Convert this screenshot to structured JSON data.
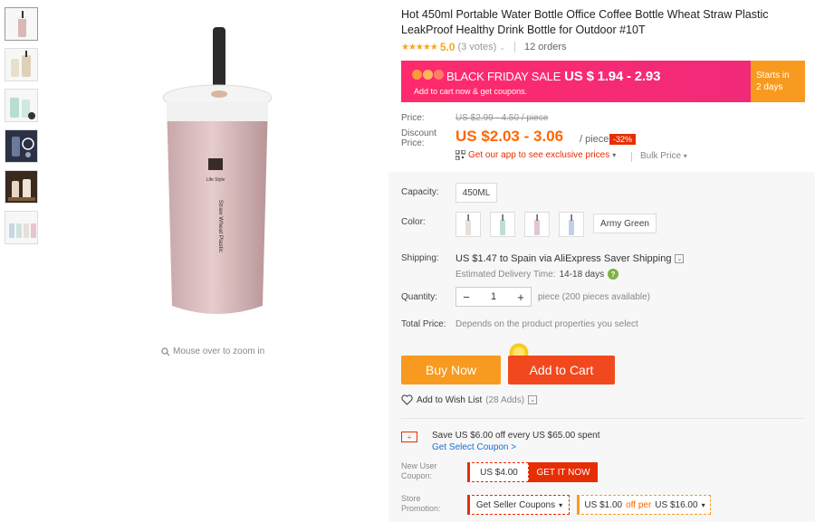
{
  "thumbnails": [
    {
      "name": "thumb-pink-bottle"
    },
    {
      "name": "thumb-beige-bottles"
    },
    {
      "name": "thumb-mint-bottles"
    },
    {
      "name": "thumb-dark-promo"
    },
    {
      "name": "thumb-lifestyle"
    },
    {
      "name": "thumb-four-colors"
    }
  ],
  "main_image": {
    "bottle_label": "Straw Wheat Plastic"
  },
  "zoom_hint": "Mouse over to zoom in",
  "product": {
    "title": "Hot 450ml Portable Water Bottle Office Coffee Bottle Wheat Straw Plastic LeakProof Healthy Drink Bottle for Outdoor #10T",
    "stars": "★★★★★",
    "rating": "5.0",
    "votes": "(3 votes)",
    "orders": "12 orders"
  },
  "banner": {
    "title": "BLACK FRIDAY SALE",
    "price": "US $ 1.94 - 2.93",
    "subtitle": "Add to cart now & get coupons.",
    "starts_label": "Starts in",
    "starts_value": "2 days",
    "color": "#ff2a6d",
    "side_color": "#f89a1f"
  },
  "price": {
    "price_label": "Price:",
    "old_price": "US $2.99 - 4.50 / piece",
    "discount_label": "Discount Price:",
    "new_price": "US $2.03 - 3.06",
    "per_piece": "/ piece",
    "discount_badge": "-32%",
    "app_link": "Get our app to see exclusive prices",
    "bulk_price": "Bulk Price"
  },
  "properties": {
    "capacity_label": "Capacity:",
    "capacity_value": "450ML",
    "color_label": "Color:",
    "color_swatches": [
      "#e8e0d8",
      "#cfe3dc",
      "#e6d5e3",
      "#c8d4e8"
    ],
    "color_text_option": "Army Green",
    "shipping_label": "Shipping:",
    "shipping_value": "US $1.47 to Spain via AliExpress Saver Shipping",
    "delivery_label": "Estimated Delivery Time:",
    "delivery_value": "14-18 days",
    "quantity_label": "Quantity:",
    "quantity_value": "1",
    "quantity_note": "piece (200 pieces available)",
    "total_label": "Total Price:",
    "total_note": "Depends on the product properties you select"
  },
  "actions": {
    "buy_now": "Buy Now",
    "add_to_cart": "Add to Cart",
    "wishlist": "Add to Wish List",
    "wishlist_count": "(28 Adds)"
  },
  "coupons": {
    "save_text": "Save US $6.00 off every US $65.00 spent",
    "get_coupon": "Get Select Coupon >",
    "new_user_label": "New User Coupon:",
    "new_user_value": "US $4.00",
    "get_it_now": "GET IT NOW",
    "store_label": "Store Promotion:",
    "seller_coupons": "Get Seller Coupons",
    "store_promo_value": "US $1.00",
    "store_promo_off": "off per",
    "store_promo_threshold": "US $16.00"
  }
}
